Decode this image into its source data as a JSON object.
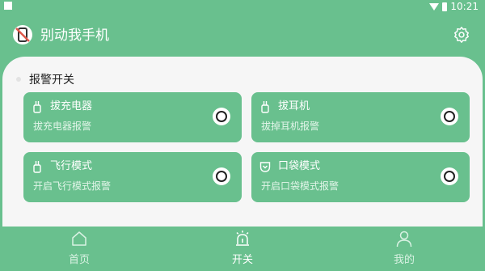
{
  "status_bar": {
    "time": "10:21"
  },
  "header": {
    "title": "别动我手机",
    "logo_icon": "no-phone-icon",
    "settings_icon": "gear-icon"
  },
  "section": {
    "title": "报警开关"
  },
  "cards": [
    {
      "title": "拔充电器",
      "desc": "拔充电器报警",
      "icon": "plug-icon",
      "enabled": false
    },
    {
      "title": "拔耳机",
      "desc": "拔掉耳机报警",
      "icon": "plug-icon",
      "enabled": false
    },
    {
      "title": "飞行模式",
      "desc": "开启飞行模式报警",
      "icon": "plug-icon",
      "enabled": false
    },
    {
      "title": "口袋模式",
      "desc": "开启口袋模式报警",
      "icon": "pocket-icon",
      "enabled": false
    }
  ],
  "nav": [
    {
      "label": "首页",
      "icon": "home-icon",
      "active": false
    },
    {
      "label": "开关",
      "icon": "alarm-icon",
      "active": true
    },
    {
      "label": "我的",
      "icon": "user-icon",
      "active": false
    }
  ],
  "colors": {
    "primary": "#69c08e",
    "background": "#f6f6f6"
  }
}
